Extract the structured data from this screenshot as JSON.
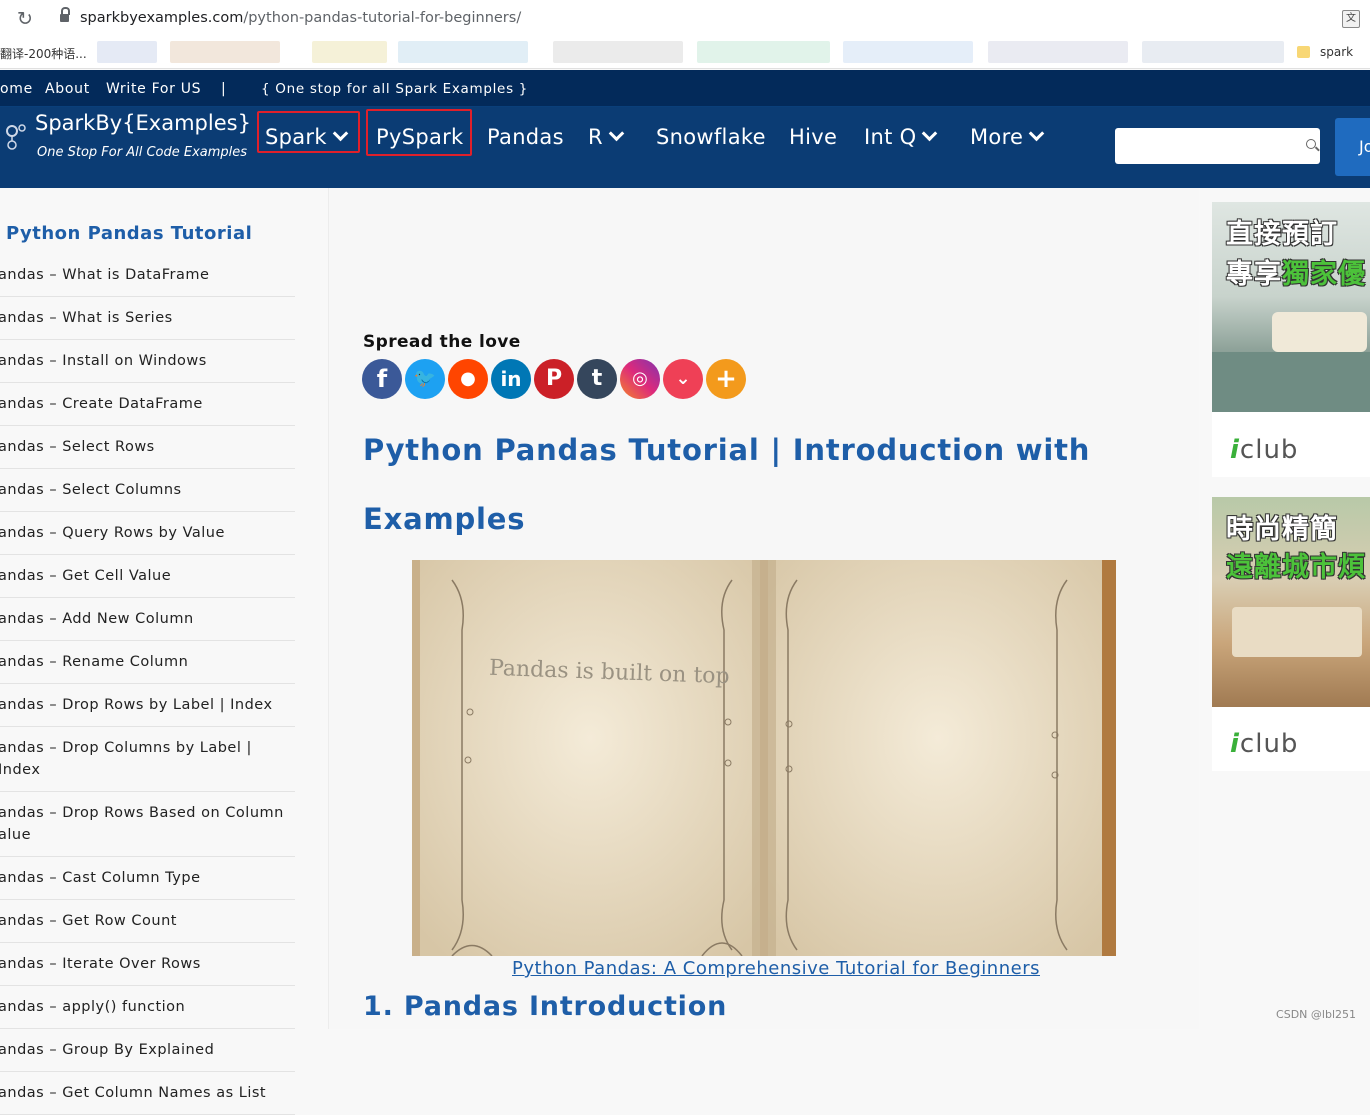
{
  "browser": {
    "url_host": "sparkbyexamples.com",
    "url_path": "/python-pandas-tutorial-for-beginners/",
    "bookmarks_first": "翻译-200种语...",
    "bookmarks_last": "spark"
  },
  "toplinks": {
    "home": "ome",
    "about": "About",
    "write": "Write For US",
    "sep": "|",
    "tagline": "{ One stop for all Spark Examples }"
  },
  "logo": {
    "title": "SparkBy{Examples}",
    "tagline": "One Stop For All Code Examples"
  },
  "nav": {
    "items": [
      "Spark",
      "PySpark",
      "Pandas",
      "R",
      "Snowflake",
      "Hive",
      "Int Q",
      "More"
    ],
    "join": "Jo"
  },
  "sidebar": {
    "title": "Python Pandas Tutorial",
    "items": [
      "andas – What is DataFrame",
      "andas – What is Series",
      "andas – Install on Windows",
      "andas – Create DataFrame",
      "andas – Select Rows",
      "andas – Select Columns",
      "andas – Query Rows by Value",
      "andas – Get Cell Value",
      "andas – Add New Column",
      "andas – Rename Column",
      "andas – Drop Rows by Label | Index",
      "andas – Drop Columns by Label | Index",
      "andas – Drop Rows Based on Column alue",
      "andas – Cast Column Type",
      "andas – Get Row Count",
      "andas – Iterate Over Rows",
      "andas – apply() function",
      "andas – Group By Explained",
      "andas – Get Column Names as List"
    ]
  },
  "content": {
    "spread": "Spread the love",
    "socials": [
      "facebook",
      "twitter",
      "reddit",
      "linkedin",
      "pinterest",
      "tumblr",
      "instagram",
      "pocket",
      "more"
    ],
    "title": "Python Pandas Tutorial | Introduction with Examples",
    "hero_text": "Pandas is built on top",
    "caption": "Python Pandas: A Comprehensive Tutorial for Beginners",
    "section": "1. Pandas Introduction"
  },
  "ads": [
    {
      "line1": "直接預訂",
      "line2a": "專享",
      "line2b": "獨家優",
      "brand": "club"
    },
    {
      "line1": "時尚精簡",
      "line2b": "遠離城市煩",
      "brand": "club"
    }
  ],
  "watermark": "CSDN @lbl251",
  "colors": {
    "nav_bg": "#0b3c74",
    "accent": "#1e5ea8",
    "highlight": "#e0202a"
  }
}
